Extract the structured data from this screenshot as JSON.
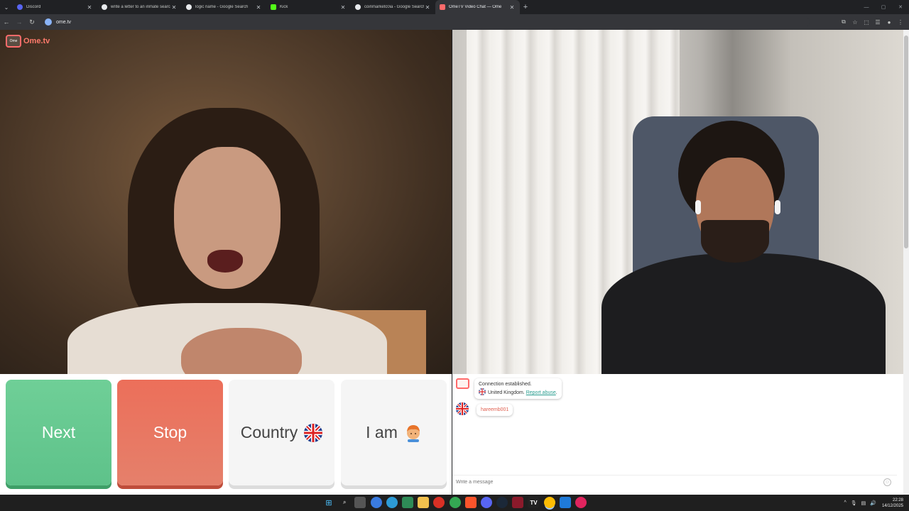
{
  "browser": {
    "tabs": [
      {
        "title": "Discord",
        "favicon_color": "#5865f2",
        "active": false
      },
      {
        "title": "write a letter to an inmate searc",
        "favicon_color": "#e8eaed",
        "active": false
      },
      {
        "title": "logic name - Google Search",
        "favicon_color": "#e8eaed",
        "active": false
      },
      {
        "title": "Kick",
        "favicon_color": "#53fc18",
        "active": false
      },
      {
        "title": "coinmarketc0ia - Google Search",
        "favicon_color": "#e8eaed",
        "active": false
      },
      {
        "title": "OmeTV Video Chat — Ome",
        "favicon_color": "#ff6b6b",
        "active": true
      }
    ],
    "url": "ome.tv"
  },
  "site": {
    "logo_text": "Ome.tv",
    "logo_box_text": "Ome"
  },
  "controls": {
    "next_label": "Next",
    "stop_label": "Stop",
    "country_label": "Country",
    "iam_label": "I am"
  },
  "chat": {
    "system_message": {
      "line1": "Connection established.",
      "country": "United Kingdom.",
      "report_link": "Report abuse"
    },
    "messages": [
      {
        "username": "hareemb001"
      }
    ],
    "input_placeholder": "Write a message"
  },
  "taskbar": {
    "time": "22:28",
    "date": "14/12/2025"
  },
  "colors": {
    "next": "#6fcf97",
    "stop": "#ec6f5a",
    "brand": "#ff6b6b"
  }
}
